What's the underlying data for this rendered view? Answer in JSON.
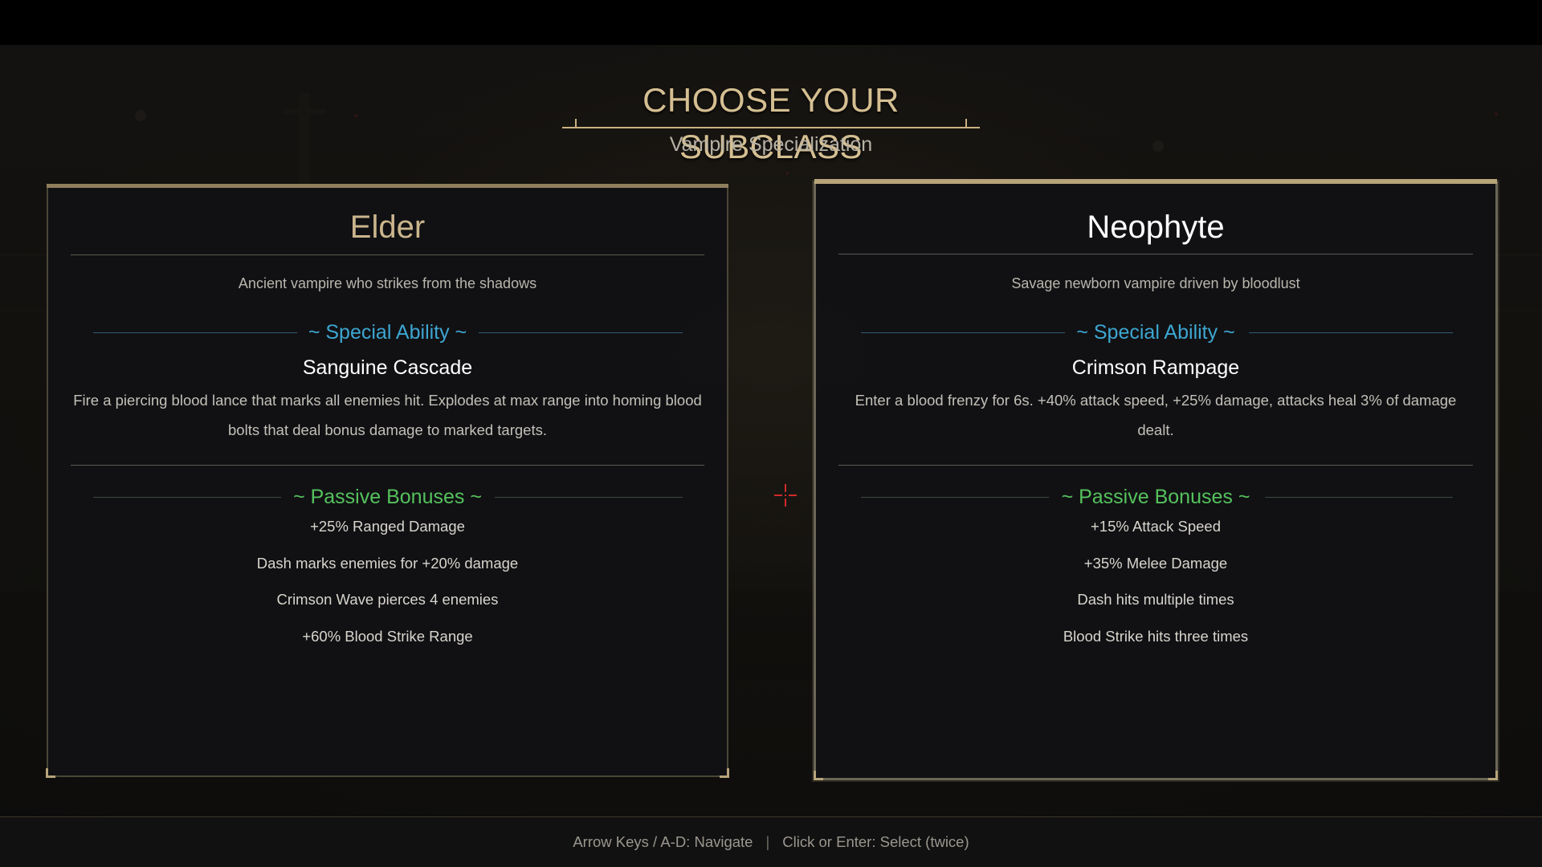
{
  "screen": {
    "title": "CHOOSE YOUR SUBCLASS",
    "subtitle": "Vampire Specialization"
  },
  "cards": [
    {
      "name": "Elder",
      "description": "Ancient vampire who strikes from the shadows",
      "special_ability_heading": "~ Special Ability ~",
      "ability_name": "Sanguine Cascade",
      "ability_description": "Fire a piercing blood lance that marks all enemies hit. Explodes at max range into homing blood bolts that deal bonus damage to marked targets.",
      "passive_heading": "~ Passive Bonuses ~",
      "bonuses": [
        "+25% Ranged Damage",
        "Dash marks enemies for +20% damage",
        "Crimson Wave pierces 4 enemies",
        "+60% Blood Strike Range"
      ],
      "selected": false
    },
    {
      "name": "Neophyte",
      "description": "Savage newborn vampire driven by bloodlust",
      "special_ability_heading": "~ Special Ability ~",
      "ability_name": "Crimson Rampage",
      "ability_description": "Enter a blood frenzy for 6s. +40% attack speed, +25% damage, attacks heal 3% of damage dealt.",
      "passive_heading": "~ Passive Bonuses ~",
      "bonuses": [
        "+15% Attack Speed",
        "+35% Melee Damage",
        "Dash hits multiple times",
        "Blood Strike hits three times"
      ],
      "selected": true
    }
  ],
  "footer": {
    "navigate_hint": "Arrow Keys / A-D: Navigate",
    "separator": "|",
    "select_hint": "Click or Enter: Select (twice)"
  },
  "colors": {
    "title_gold": "#d5bf92",
    "ability_blue": "#3da6d1",
    "passive_green": "#55c25c",
    "crosshair_red": "#d22a2a"
  },
  "icons": {
    "cursor": "crosshair-icon"
  }
}
